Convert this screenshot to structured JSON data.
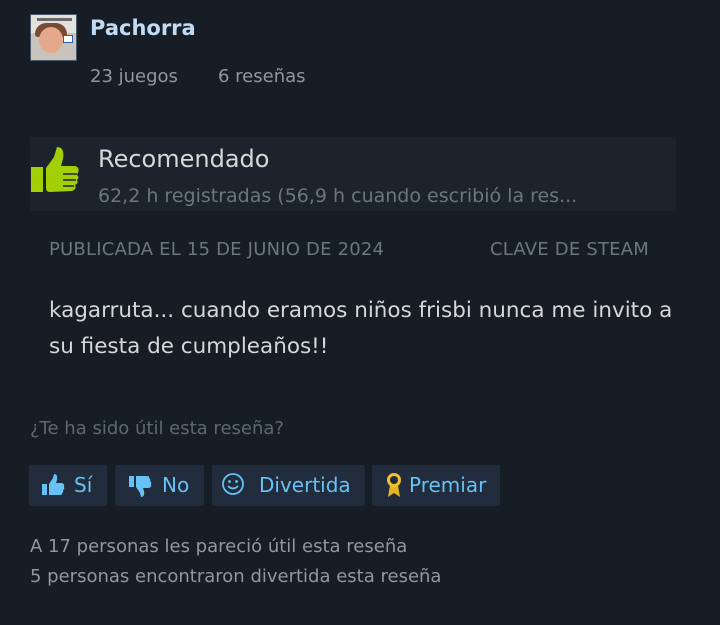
{
  "author": {
    "name": "Pachorra",
    "games_owned": "23 juegos",
    "review_count": "6 reseñas"
  },
  "review": {
    "verdict": "Recomendado",
    "hours": "62,2 h registradas (56,9 h cuando escribió la res...",
    "posted": "PUBLICADA EL 15 DE JUNIO DE 2024",
    "source": "CLAVE DE STEAM",
    "text": "kagarruta... cuando eramos niños frisbi nunca me invito a su fiesta de cumpleaños!!"
  },
  "feedback": {
    "question": "¿Te ha sido útil esta reseña?",
    "yes_label": "Sí",
    "no_label": "No",
    "funny_label": "Divertida",
    "award_label": "Premiar"
  },
  "summary": {
    "helpful": "A 17 personas les pareció útil esta reseña",
    "funny": "5 personas encontraron divertida esta reseña"
  },
  "colors": {
    "background": "#171d25",
    "accent": "#67c1f5",
    "thumb": "#a3cf06",
    "button_bg": "#212c3d"
  },
  "icons": {
    "verdict": "thumbs-up-icon",
    "yes": "thumbs-up-icon",
    "no": "thumbs-down-icon",
    "funny": "smiley-icon",
    "award": "award-ribbon-icon"
  }
}
